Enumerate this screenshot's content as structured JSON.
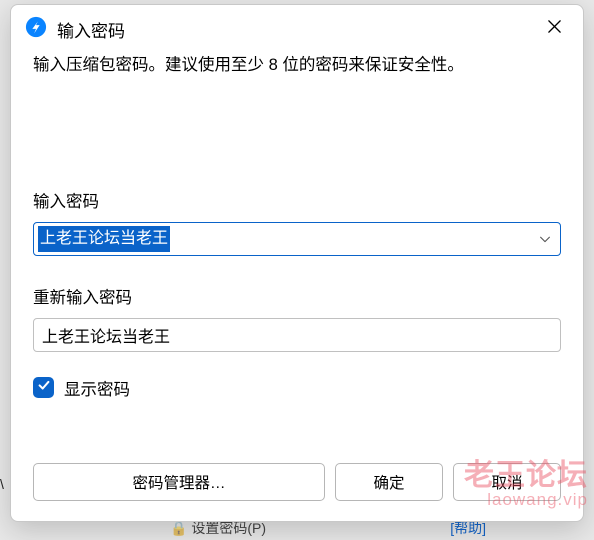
{
  "dialog": {
    "title": "输入密码",
    "instruction": "输入压缩包密码。建议使用至少 8 位的密码来保证安全性。",
    "password_label": "输入密码",
    "password_value": "上老王论坛当老王",
    "confirm_label": "重新输入密码",
    "confirm_value": "上老王论坛当老王",
    "show_password_label": "显示密码",
    "show_password_checked": true,
    "buttons": {
      "password_manager": "密码管理器…",
      "ok": "确定",
      "cancel": "取消"
    }
  },
  "background": {
    "frag1": "设置密码(P)",
    "frag2": "[帮助]",
    "left": "\\"
  },
  "watermark": {
    "big": "老王论坛",
    "small": "laowang.vip"
  },
  "colors": {
    "accent": "#0a63c9",
    "watermark": "rgba(232,78,95,0.45)"
  }
}
